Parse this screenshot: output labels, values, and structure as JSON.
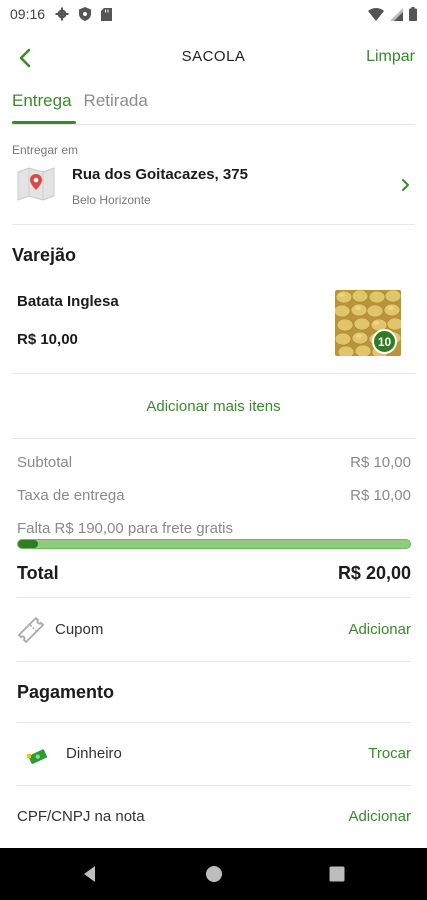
{
  "status_bar": {
    "time": "09:16",
    "icons": [
      "gear-icon",
      "shield-icon",
      "sd-card-icon",
      "wifi-icon",
      "signal-icon",
      "battery-icon"
    ]
  },
  "header": {
    "title": "SACOLA",
    "clear_label": "Limpar",
    "back_icon": "back-arrow-icon"
  },
  "tabs": [
    {
      "label": "Entrega",
      "active": true
    },
    {
      "label": "Retirada",
      "active": false
    }
  ],
  "delivery": {
    "label": "Entregar em",
    "street": "Rua dos Goitacazes, 375",
    "city": "Belo Horizonte"
  },
  "store": {
    "name": "Varejão",
    "items": [
      {
        "name": "Batata Inglesa",
        "price": "R$ 10,00",
        "quantity": "10"
      }
    ],
    "add_more_label": "Adicionar mais itens"
  },
  "summary": {
    "subtotal_label": "Subtotal",
    "subtotal_value": "R$ 10,00",
    "delivery_fee_label": "Taxa de entrega",
    "delivery_fee_value": "R$ 10,00",
    "free_shipping_text": "Falta R$ 190,00 para frete gratis",
    "free_shipping_progress": 0.05,
    "total_label": "Total",
    "total_value": "R$ 20,00"
  },
  "coupon": {
    "label": "Cupom",
    "action": "Adicionar"
  },
  "payment": {
    "title": "Pagamento",
    "method": "Dinheiro",
    "action": "Trocar"
  },
  "cpf": {
    "label": "CPF/CNPJ na nota",
    "action": "Adicionar"
  },
  "colors": {
    "accent": "#3a8a2c",
    "accent_dark": "#2e7d22",
    "progress_track": "#8fcc7f",
    "text_muted": "#8a8a8a"
  }
}
